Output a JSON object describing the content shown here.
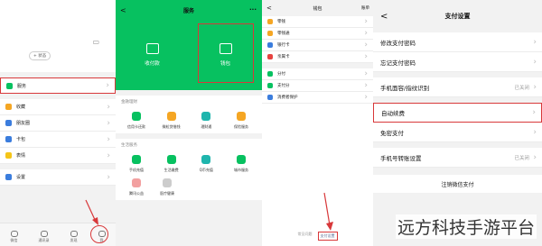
{
  "panel1": {
    "status_pill": "+ 状态",
    "menu": [
      {
        "label": "服务",
        "color": "#07c160"
      },
      {
        "label": "收藏",
        "color": "#f5a623"
      },
      {
        "label": "朋友圈",
        "color": "#3b7ddd"
      },
      {
        "label": "卡包",
        "color": "#3b7ddd"
      },
      {
        "label": "表情",
        "color": "#f5c518"
      },
      {
        "label": "设置",
        "color": "#3b7ddd"
      }
    ],
    "tabs": [
      "微信",
      "通讯录",
      "发现",
      "我"
    ]
  },
  "panel2": {
    "title": "服务",
    "more": "···",
    "back": "<",
    "payment_label": "收付款",
    "wallet_label": "钱包",
    "finance_title": "金融理财",
    "finance_items": [
      {
        "label": "信用卡还款",
        "color": "#07c160"
      },
      {
        "label": "微粒贷借钱",
        "color": "#f5a623"
      },
      {
        "label": "理财通",
        "color": "#1fb5ad"
      },
      {
        "label": "保险服务",
        "color": "#f5a623"
      }
    ],
    "life_title": "生活服务",
    "life_items": [
      {
        "label": "手机充值",
        "color": "#07c160"
      },
      {
        "label": "生活缴费",
        "color": "#07c160"
      },
      {
        "label": "Q币充值",
        "color": "#1fb5ad"
      },
      {
        "label": "城市服务",
        "color": "#07c160"
      }
    ],
    "life_items2": [
      {
        "label": "腾讯公益",
        "color": "#f2a0a0"
      },
      {
        "label": "医疗健康",
        "color": "#ccc"
      }
    ]
  },
  "panel3": {
    "title": "钱包",
    "bill": "账单",
    "back": "<",
    "group1": [
      {
        "label": "零钱",
        "color": "#f5a623"
      },
      {
        "label": "零钱通",
        "color": "#f5a623"
      },
      {
        "label": "银行卡",
        "color": "#3b7ddd"
      },
      {
        "label": "亲属卡",
        "color": "#e64340"
      }
    ],
    "group2": [
      {
        "label": "分付",
        "color": "#07c160"
      },
      {
        "label": "支付分",
        "color": "#07c160"
      },
      {
        "label": "消费者保护",
        "color": "#3b7ddd"
      }
    ],
    "footer_left": "常见问题",
    "footer_right": "支付设置"
  },
  "panel4": {
    "title": "支付设置",
    "back": "<",
    "group1": [
      "修改支付密码",
      "忘记支付密码"
    ],
    "biometric": {
      "label": "手机面容/指纹识别",
      "value": "已关闭"
    },
    "autopay": "自动续费",
    "nopwd": "免密支付",
    "transfer": {
      "label": "手机号转账设置",
      "value": "已关闭"
    },
    "logout": "注销微信支付"
  },
  "watermark": "远方科技手游平台"
}
